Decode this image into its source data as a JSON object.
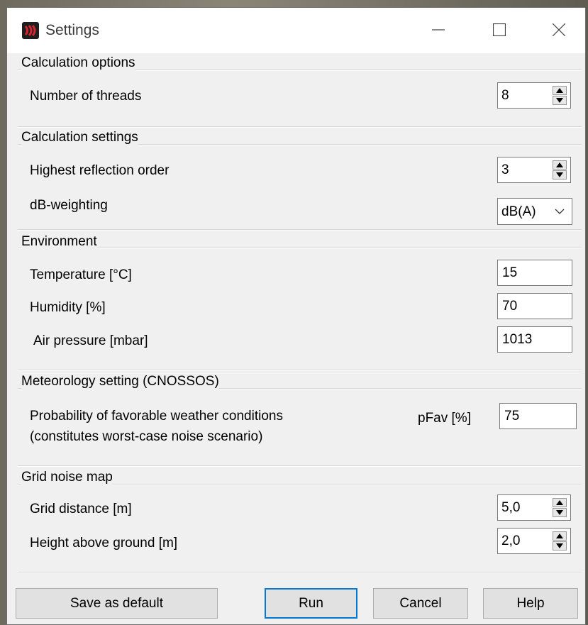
{
  "window": {
    "title": "Settings"
  },
  "sections": {
    "calc_options": {
      "title": "Calculation options",
      "threads_label": "Number of threads",
      "threads_value": "8"
    },
    "calc_settings": {
      "title": "Calculation settings",
      "reflection_label": "Highest reflection order",
      "reflection_value": "3",
      "weighting_label": "dB-weighting",
      "weighting_value": "dB(A)"
    },
    "environment": {
      "title": "Environment",
      "temperature_label": "Temperature [°C]",
      "temperature_value": "15",
      "humidity_label": "Humidity [%]",
      "humidity_value": "70",
      "pressure_label": "Air pressure [mbar]",
      "pressure_value": "1013"
    },
    "meteorology": {
      "title": "Meteorology setting (CNOSSOS)",
      "prob_label_line1": "Probability of favorable weather conditions",
      "prob_label_line2": "(constitutes worst-case noise scenario)",
      "pfav_label": "pFav [%]",
      "pfav_value": "75"
    },
    "grid": {
      "title": "Grid noise map",
      "distance_label": "Grid distance [m]",
      "distance_value": "5,0",
      "height_label": "Height above ground [m]",
      "height_value": "2,0"
    }
  },
  "buttons": {
    "save_default": "Save as default",
    "run": "Run",
    "cancel": "Cancel",
    "help": "Help"
  },
  "colors": {
    "default_button_border": "#0078d7",
    "app_icon_red": "#d9232e"
  }
}
